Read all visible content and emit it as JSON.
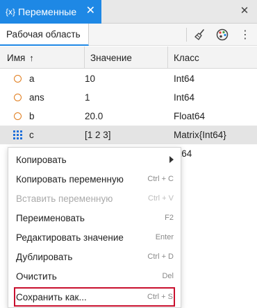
{
  "panel": {
    "title": "Переменные",
    "tab_icon": "{x}",
    "close_glyph": "✕"
  },
  "toolbar": {
    "workspace_tab": "Рабочая область",
    "more_glyph": "⋮"
  },
  "table": {
    "headers": {
      "name": "Имя",
      "sort_glyph": "↑",
      "value": "Значение",
      "class": "Класс"
    },
    "rows": [
      {
        "icon": "scalar-circle-icon",
        "name": "a",
        "value": "10",
        "class": "Int64",
        "selected": false
      },
      {
        "icon": "scalar-circle-icon",
        "name": "ans",
        "value": "1",
        "class": "Int64",
        "selected": false
      },
      {
        "icon": "scalar-circle-icon",
        "name": "b",
        "value": "20.0",
        "class": "Float64",
        "selected": false
      },
      {
        "icon": "matrix-grid-icon",
        "name": "c",
        "value": "[1 2 3]",
        "class": "Matrix{Int64}",
        "selected": true
      },
      {
        "icon": "",
        "name": "",
        "value": "",
        "class": "nt64",
        "selected": false
      }
    ]
  },
  "context_menu": {
    "items": [
      {
        "label": "Копировать",
        "shortcut": "",
        "submenu": true,
        "disabled": false
      },
      {
        "label": "Копировать переменную",
        "shortcut": "Ctrl + C",
        "submenu": false,
        "disabled": false
      },
      {
        "label": "Вставить переменную",
        "shortcut": "Ctrl + V",
        "submenu": false,
        "disabled": true
      },
      {
        "label": "Переименовать",
        "shortcut": "F2",
        "submenu": false,
        "disabled": false
      },
      {
        "label": "Редактировать значение",
        "shortcut": "Enter",
        "submenu": false,
        "disabled": false
      },
      {
        "label": "Дублировать",
        "shortcut": "Ctrl + D",
        "submenu": false,
        "disabled": false
      },
      {
        "label": "Очистить",
        "shortcut": "Del",
        "submenu": false,
        "disabled": false
      },
      {
        "label": "Сохранить как...",
        "shortcut": "Ctrl + S",
        "submenu": false,
        "disabled": false,
        "highlighted": true
      }
    ]
  },
  "colors": {
    "accent": "#1e88e5",
    "scalar_icon": "#e07b1a",
    "matrix_icon": "#1e6fd9",
    "highlight_box": "#c8102e"
  }
}
